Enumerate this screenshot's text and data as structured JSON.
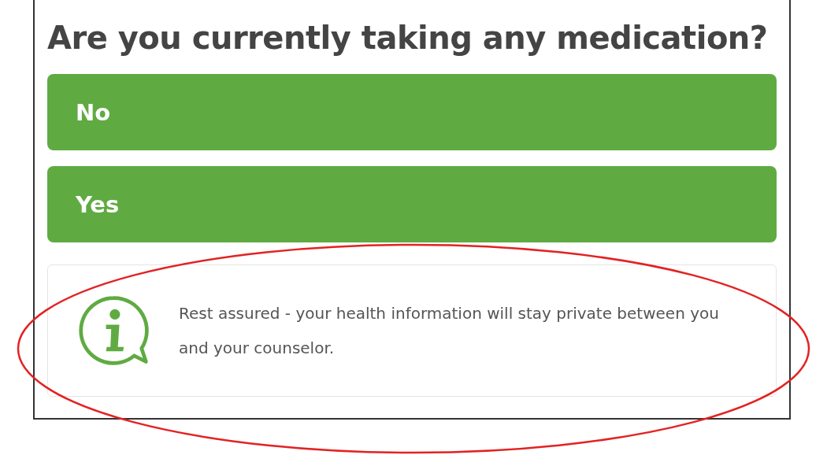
{
  "question": "Are you currently taking any medication?",
  "options": [
    {
      "label": "No"
    },
    {
      "label": "Yes"
    }
  ],
  "note": {
    "text": "Rest assured - your health information will stay private between you and your counselor."
  },
  "annotations": [
    {
      "kind": "ellipse"
    }
  ]
}
